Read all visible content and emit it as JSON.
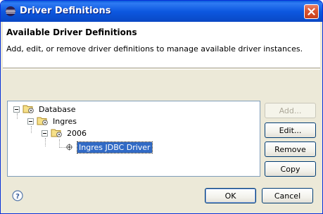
{
  "window": {
    "title": "Driver Definitions",
    "colors": {
      "titlebar": "#0a5bdc",
      "selection": "#316ac5",
      "close": "#d9532f"
    }
  },
  "header": {
    "title": "Available Driver Definitions",
    "description": "Add, edit, or remove driver definitions to manage available driver instances."
  },
  "tree": {
    "items": [
      {
        "label": "Database",
        "icon": "folder-gear-icon",
        "expanded": true
      },
      {
        "label": "Ingres",
        "icon": "folder-gear-icon",
        "expanded": true
      },
      {
        "label": "2006",
        "icon": "folder-gear-icon",
        "expanded": true
      },
      {
        "label": "Ingres JDBC Driver",
        "icon": "driver-gear-icon",
        "selected": true
      }
    ]
  },
  "buttons": {
    "add": "Add...",
    "edit": "Edit...",
    "remove": "Remove",
    "copy": "Copy",
    "ok": "OK",
    "cancel": "Cancel"
  }
}
